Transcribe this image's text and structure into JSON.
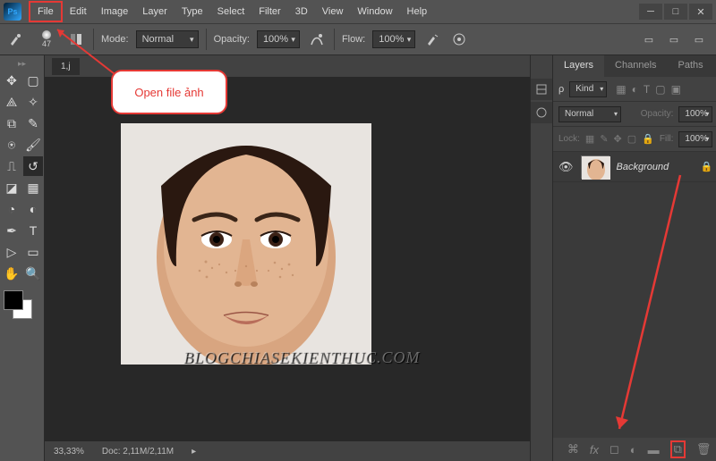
{
  "menubar": {
    "items": [
      "File",
      "Edit",
      "Image",
      "Layer",
      "Type",
      "Select",
      "Filter",
      "3D",
      "View",
      "Window",
      "Help"
    ]
  },
  "options": {
    "mode_label": "Mode:",
    "mode_value": "Normal",
    "opacity_label": "Opacity:",
    "opacity_value": "100%",
    "flow_label": "Flow:",
    "flow_value": "100%",
    "brush_size": "47"
  },
  "document": {
    "tab": "1,j",
    "zoom": "33,33%",
    "doc_size": "Doc:  2,11M/2,11M"
  },
  "callout": {
    "text": "Open file ảnh"
  },
  "layers_panel": {
    "tabs": [
      "Layers",
      "Channels",
      "Paths"
    ],
    "kind_label": "Kind",
    "blend_mode": "Normal",
    "opacity_label": "Opacity:",
    "opacity_value": "100%",
    "lock_label": "Lock:",
    "fill_label": "Fill:",
    "fill_value": "100%",
    "layer": {
      "name": "Background"
    }
  },
  "watermark": "BLOGCHIASEKIENTHUC.COM"
}
